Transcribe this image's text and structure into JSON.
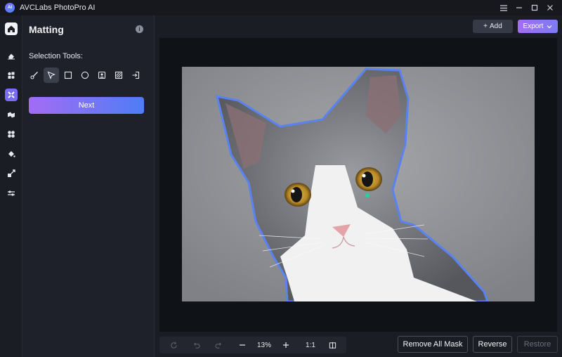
{
  "app": {
    "title": "AVCLabs PhotoPro AI",
    "logo_text": "AI"
  },
  "window": {
    "menu_icon": "menu-icon",
    "minimize_icon": "minimize-icon",
    "maximize_icon": "maximize-icon",
    "close_icon": "close-icon"
  },
  "rail": {
    "items": [
      "home-icon",
      "eraser-icon",
      "replace-icon",
      "matting-icon",
      "enhance-icon",
      "fan-icon",
      "fill-icon",
      "resize-icon",
      "adjust-icon"
    ],
    "active": "matting-icon"
  },
  "panel": {
    "title": "Matting",
    "selection_label": "Selection Tools:",
    "tools": [
      "brush-tool-icon",
      "smart-select-icon",
      "rectangle-select-icon",
      "ellipse-select-icon",
      "portrait-select-icon",
      "hatch-select-icon",
      "import-mask-icon"
    ],
    "next_label": "Next"
  },
  "topbar": {
    "add_label": "Add",
    "export_label": "Export"
  },
  "zoombar": {
    "zoom_level": "13%",
    "actual_size_label": "1:1"
  },
  "actions": {
    "remove_all_mask": "Remove All Mask",
    "reverse": "Reverse",
    "restore": "Restore"
  },
  "colors": {
    "accent_start": "#a36cf3",
    "accent_end": "#4f7df5",
    "mask_outline": "#4f7df5"
  }
}
